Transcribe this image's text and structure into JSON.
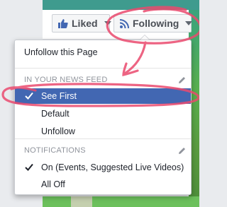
{
  "page_buttons": {
    "liked_label": "Liked",
    "following_label": "Following"
  },
  "menu": {
    "unfollow_page": "Unfollow this Page",
    "news_feed_header": "IN YOUR NEWS FEED",
    "news_feed_items": [
      "See First",
      "Default",
      "Unfollow"
    ],
    "selected_news_feed": "See First",
    "notifications_header": "NOTIFICATIONS",
    "notification_items": [
      "On (Events, Suggested Live Videos)",
      "All Off"
    ],
    "selected_notification": "On (Events, Suggested Live Videos)"
  },
  "colors": {
    "selected_bg": "#4267b2",
    "annotation": "#ea4a6e"
  },
  "icons": [
    "thumbs-up-icon",
    "rss-icon",
    "chevron-down-icon",
    "checkmark-icon",
    "pencil-icon"
  ]
}
